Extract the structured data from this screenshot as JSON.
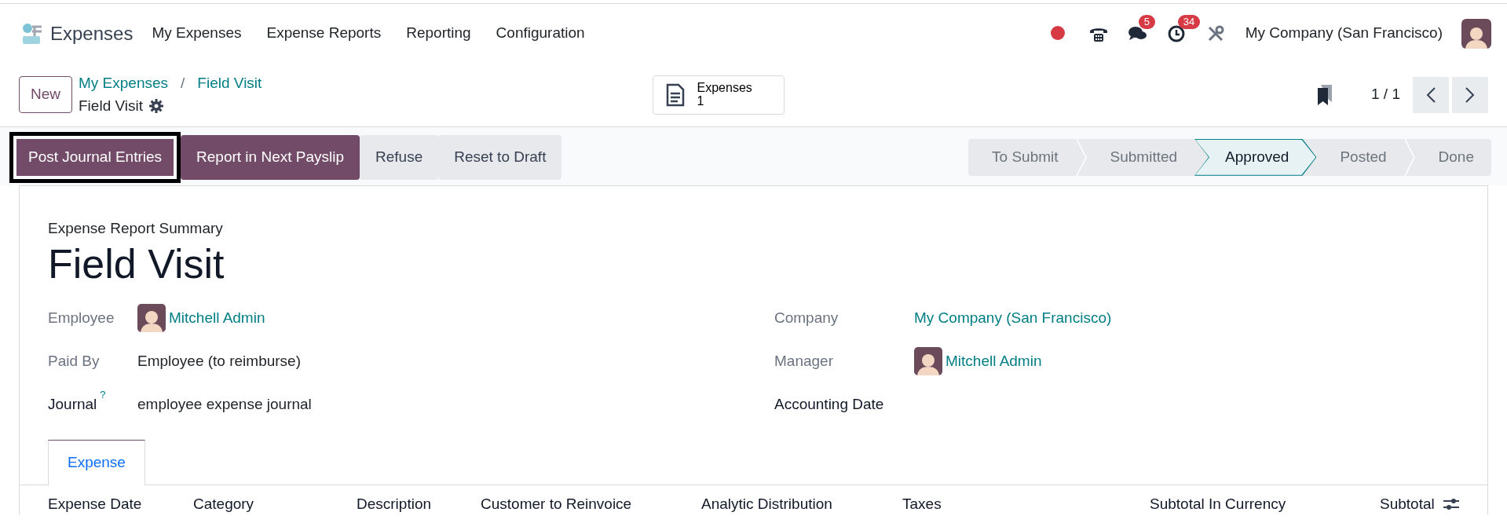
{
  "navbar": {
    "app_name": "Expenses",
    "menu": [
      "My Expenses",
      "Expense Reports",
      "Reporting",
      "Configuration"
    ],
    "systray": [
      {
        "kind": "dot"
      },
      {
        "kind": "phone"
      },
      {
        "kind": "chat",
        "badge": "5"
      },
      {
        "kind": "clock",
        "badge": "34"
      },
      {
        "kind": "tools"
      }
    ],
    "company": "My Company (San Francisco)"
  },
  "control_panel": {
    "new_button": "New",
    "breadcrumbs": [
      "My Expenses",
      "Field Visit"
    ],
    "breadcrumb_separator": "/",
    "record_title": "Field Visit",
    "smart_button": {
      "label": "Expenses",
      "count": "1"
    },
    "pager": "1 / 1"
  },
  "actions": [
    {
      "label": "Post Journal Entries",
      "kind": "primary",
      "highlighted": true
    },
    {
      "label": "Report in Next Payslip",
      "kind": "primary",
      "highlighted": false
    },
    {
      "label": "Refuse",
      "kind": "secondary",
      "highlighted": false
    },
    {
      "label": "Reset to Draft",
      "kind": "secondary",
      "highlighted": false
    }
  ],
  "statusbar": [
    {
      "label": "To Submit",
      "selected": false
    },
    {
      "label": "Submitted",
      "selected": false
    },
    {
      "label": "Approved",
      "selected": true
    },
    {
      "label": "Posted",
      "selected": false
    },
    {
      "label": "Done",
      "selected": false
    }
  ],
  "form": {
    "subtitle": "Expense Report Summary",
    "title": "Field Visit",
    "left_fields": [
      {
        "label": "Employee",
        "value": "Mitchell Admin",
        "kind": "avatar_link",
        "required": false
      },
      {
        "label": "Paid By",
        "value": "Employee (to reimburse)",
        "kind": "text",
        "required": false
      },
      {
        "label": "Journal",
        "help": "?",
        "value": "employee expense journal",
        "kind": "text",
        "required": true
      }
    ],
    "right_fields": [
      {
        "label": "Company",
        "value": "My Company (San Francisco)",
        "kind": "link",
        "required": false
      },
      {
        "label": "Manager",
        "value": "Mitchell Admin",
        "kind": "avatar_link",
        "required": false
      },
      {
        "label": "Accounting Date",
        "kind": "empty",
        "required": true
      }
    ]
  },
  "tabs": [
    {
      "label": "Expense",
      "selected": true
    }
  ],
  "table": {
    "columns": [
      "Expense Date",
      "Category",
      "Description",
      "Customer to Reinvoice",
      "Analytic Distribution",
      "Taxes",
      "Subtotal In Currency",
      "Subtotal"
    ]
  }
}
